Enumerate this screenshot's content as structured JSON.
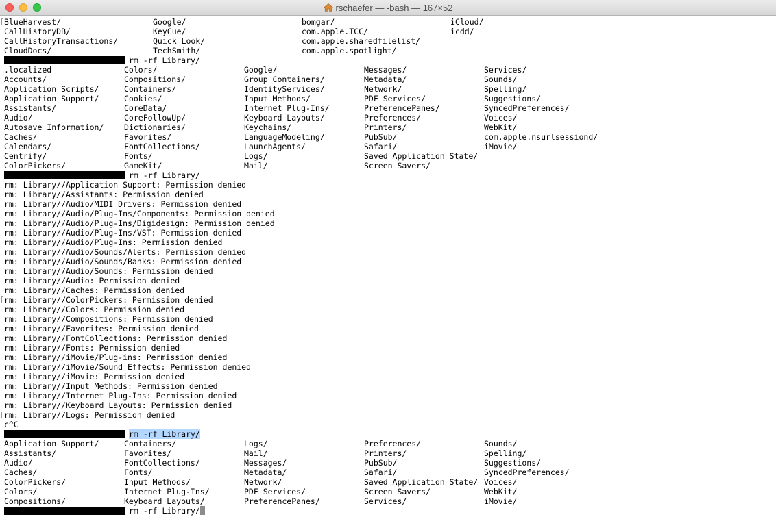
{
  "window": {
    "title": "rschaefer — -bash — 167×52"
  },
  "terminal": {
    "block1": [
      [
        "BlueHarvest/",
        "Google/",
        "bomgar/",
        "iCloud/"
      ],
      [
        "CallHistoryDB/",
        "KeyCue/",
        "com.apple.TCC/",
        "icdd/"
      ],
      [
        "CallHistoryTransactions/",
        "Quick Look/",
        "com.apple.sharedfilelist/",
        ""
      ],
      [
        "CloudDocs/",
        "TechSmith/",
        "com.apple.spotlight/",
        ""
      ]
    ],
    "prompt1": {
      "command": "rm -rf Library/"
    },
    "block2": [
      [
        ".localized",
        "Colors/",
        "Google/",
        "Messages/",
        "Services/"
      ],
      [
        "Accounts/",
        "Compositions/",
        "Group Containers/",
        "Metadata/",
        "Sounds/"
      ],
      [
        "Application Scripts/",
        "Containers/",
        "IdentityServices/",
        "Network/",
        "Spelling/"
      ],
      [
        "Application Support/",
        "Cookies/",
        "Input Methods/",
        "PDF Services/",
        "Suggestions/"
      ],
      [
        "Assistants/",
        "CoreData/",
        "Internet Plug-Ins/",
        "PreferencePanes/",
        "SyncedPreferences/"
      ],
      [
        "Audio/",
        "CoreFollowUp/",
        "Keyboard Layouts/",
        "Preferences/",
        "Voices/"
      ],
      [
        "Autosave Information/",
        "Dictionaries/",
        "Keychains/",
        "Printers/",
        "WebKit/"
      ],
      [
        "Caches/",
        "Favorites/",
        "LanguageModeling/",
        "PubSub/",
        "com.apple.nsurlsessiond/"
      ],
      [
        "Calendars/",
        "FontCollections/",
        "LaunchAgents/",
        "Safari/",
        "iMovie/"
      ],
      [
        "Centrify/",
        "Fonts/",
        "Logs/",
        "Saved Application State/",
        ""
      ],
      [
        "ColorPickers/",
        "GameKit/",
        "Mail/",
        "Screen Savers/",
        ""
      ]
    ],
    "prompt2": {
      "command": "rm -rf Library/"
    },
    "errors": [
      "rm: Library//Application Support: Permission denied",
      "rm: Library//Assistants: Permission denied",
      "rm: Library//Audio/MIDI Drivers: Permission denied",
      "rm: Library//Audio/Plug-Ins/Components: Permission denied",
      "rm: Library//Audio/Plug-Ins/Digidesign: Permission denied",
      "rm: Library//Audio/Plug-Ins/VST: Permission denied",
      "rm: Library//Audio/Plug-Ins: Permission denied",
      "rm: Library//Audio/Sounds/Alerts: Permission denied",
      "rm: Library//Audio/Sounds/Banks: Permission denied",
      "rm: Library//Audio/Sounds: Permission denied",
      "rm: Library//Audio: Permission denied",
      "rm: Library//Caches: Permission denied",
      "rm: Library//ColorPickers: Permission denied",
      "rm: Library//Colors: Permission denied",
      "rm: Library//Compositions: Permission denied",
      "rm: Library//Favorites: Permission denied",
      "rm: Library//FontCollections: Permission denied",
      "rm: Library//Fonts: Permission denied",
      "rm: Library//iMovie/Plug-ins: Permission denied",
      "rm: Library//iMovie/Sound Effects: Permission denied",
      "rm: Library//iMovie: Permission denied",
      "rm: Library//Input Methods: Permission denied",
      "rm: Library//Internet Plug-Ins: Permission denied",
      "rm: Library//Keyboard Layouts: Permission denied",
      "rm: Library//Logs: Permission denied"
    ],
    "interrupt": "c^C",
    "prompt3": {
      "command": "rm -rf Library/"
    },
    "block3": [
      [
        "Application Support/",
        "Containers/",
        "Logs/",
        "Preferences/",
        "Sounds/"
      ],
      [
        "Assistants/",
        "Favorites/",
        "Mail/",
        "Printers/",
        "Spelling/"
      ],
      [
        "Audio/",
        "FontCollections/",
        "Messages/",
        "PubSub/",
        "Suggestions/"
      ],
      [
        "Caches/",
        "Fonts/",
        "Metadata/",
        "Safari/",
        "SyncedPreferences/"
      ],
      [
        "ColorPickers/",
        "Input Methods/",
        "Network/",
        "Saved Application State/",
        "Voices/"
      ],
      [
        "Colors/",
        "Internet Plug-Ins/",
        "PDF Services/",
        "Screen Savers/",
        "WebKit/"
      ],
      [
        "Compositions/",
        "Keyboard Layouts/",
        "PreferencePanes/",
        "Services/",
        "iMovie/"
      ]
    ],
    "prompt4": {
      "command": "rm -rf Library/"
    }
  }
}
